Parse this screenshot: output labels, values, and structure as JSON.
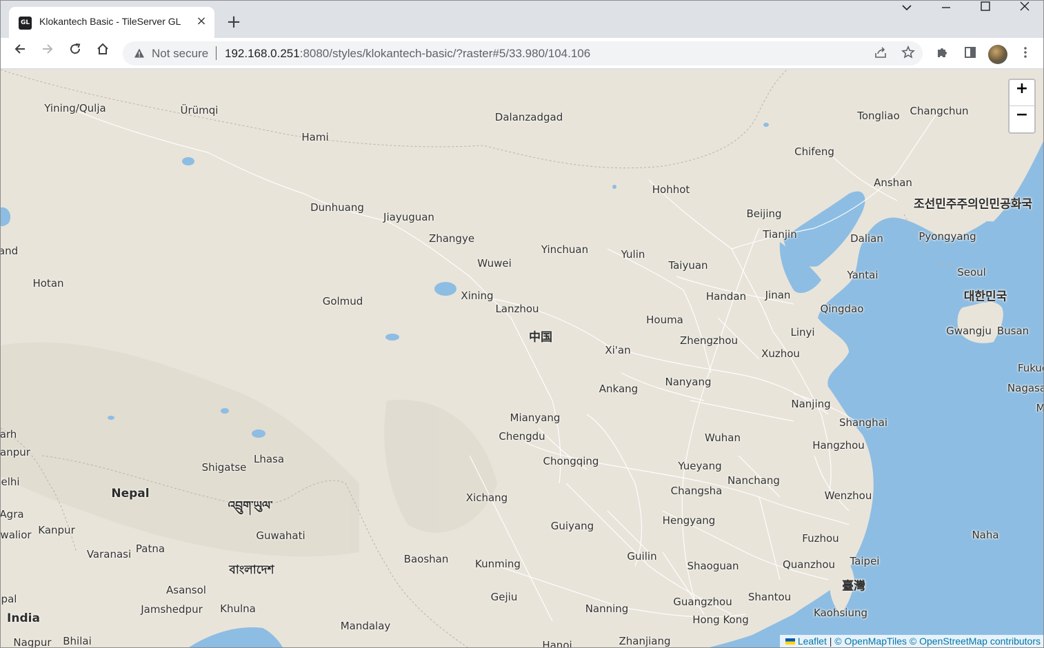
{
  "browser": {
    "tab_title": "Klokantech Basic - TileServer GL",
    "favicon_text": "GL",
    "new_tab_symbol": "+",
    "security_status": "Not secure",
    "url_host": "192.168.0.251",
    "url_rest": ":8080/styles/klokantech-basic/?raster#5/33.980/104.106"
  },
  "map": {
    "zoom_in_label": "+",
    "zoom_out_label": "−",
    "attribution": {
      "leaflet": "Leaflet",
      "separator": " | ",
      "omt": "© OpenMapTiles",
      "osm": "© OpenStreetMap contributors"
    },
    "colors": {
      "land": "#e8e4da",
      "water": "#8dbde3",
      "roads": "#ffffff",
      "borders": "#b9b4ac"
    },
    "labels": [
      {
        "text": "Yining/Qulja",
        "type": "city"
      },
      {
        "text": "Ürümqi",
        "type": "city"
      },
      {
        "text": "Dalanzadgad",
        "type": "city"
      },
      {
        "text": "Tongliao",
        "type": "city"
      },
      {
        "text": "Changchun",
        "type": "city"
      },
      {
        "text": "Hami",
        "type": "city"
      },
      {
        "text": "Chifeng",
        "type": "city"
      },
      {
        "text": "Hohhot",
        "type": "city"
      },
      {
        "text": "Anshan",
        "type": "city"
      },
      {
        "text": "조선민주주의인민공화국",
        "type": "country"
      },
      {
        "text": "Dunhuang",
        "type": "city"
      },
      {
        "text": "Jiayuguan",
        "type": "city"
      },
      {
        "text": "Beijing",
        "type": "city"
      },
      {
        "text": "Zhangye",
        "type": "city"
      },
      {
        "text": "Tianjin",
        "type": "city"
      },
      {
        "text": "Dalian",
        "type": "city"
      },
      {
        "text": "Pyongyang",
        "type": "city"
      },
      {
        "text": "and",
        "type": "city"
      },
      {
        "text": "Yinchuan",
        "type": "city"
      },
      {
        "text": "Yulin",
        "type": "city"
      },
      {
        "text": "Wuwei",
        "type": "city"
      },
      {
        "text": "Taiyuan",
        "type": "city"
      },
      {
        "text": "Seoul",
        "type": "city"
      },
      {
        "text": "Yantai",
        "type": "city"
      },
      {
        "text": "Hotan",
        "type": "city"
      },
      {
        "text": "대한민국",
        "type": "country"
      },
      {
        "text": "Xining",
        "type": "city"
      },
      {
        "text": "Handan",
        "type": "city"
      },
      {
        "text": "Jinan",
        "type": "city"
      },
      {
        "text": "Golmud",
        "type": "city"
      },
      {
        "text": "Lanzhou",
        "type": "city"
      },
      {
        "text": "Qingdao",
        "type": "city"
      },
      {
        "text": "Houma",
        "type": "city"
      },
      {
        "text": "Gwangju",
        "type": "city"
      },
      {
        "text": "Busan",
        "type": "city"
      },
      {
        "text": "中国",
        "type": "country"
      },
      {
        "text": "Linyi",
        "type": "city"
      },
      {
        "text": "Zhengzhou",
        "type": "city"
      },
      {
        "text": "Xi'an",
        "type": "city"
      },
      {
        "text": "Xuzhou",
        "type": "city"
      },
      {
        "text": "Fukuo",
        "type": "city"
      },
      {
        "text": "Nanyang",
        "type": "city"
      },
      {
        "text": "Ankang",
        "type": "city"
      },
      {
        "text": "Nagasa",
        "type": "city"
      },
      {
        "text": "Nanjing",
        "type": "city"
      },
      {
        "text": "M",
        "type": "city"
      },
      {
        "text": "Mianyang",
        "type": "city"
      },
      {
        "text": "Shanghai",
        "type": "city"
      },
      {
        "text": "arh",
        "type": "city"
      },
      {
        "text": "Chengdu",
        "type": "city"
      },
      {
        "text": "Wuhan",
        "type": "city"
      },
      {
        "text": "Hangzhou",
        "type": "city"
      },
      {
        "text": "anpur",
        "type": "city"
      },
      {
        "text": "Lhasa",
        "type": "city"
      },
      {
        "text": "Chongqing",
        "type": "city"
      },
      {
        "text": "Shigatse",
        "type": "city"
      },
      {
        "text": "Yueyang",
        "type": "city"
      },
      {
        "text": "elhi",
        "type": "city"
      },
      {
        "text": "Nanchang",
        "type": "city"
      },
      {
        "text": "Nepal",
        "type": "country"
      },
      {
        "text": "Changsha",
        "type": "city"
      },
      {
        "text": "Wenzhou",
        "type": "city"
      },
      {
        "text": "Xichang",
        "type": "city"
      },
      {
        "text": "འབྲུག་ཡུལ་",
        "type": "country"
      },
      {
        "text": "Agra",
        "type": "city"
      },
      {
        "text": "Hengyang",
        "type": "city"
      },
      {
        "text": "Kanpur",
        "type": "city"
      },
      {
        "text": "Guiyang",
        "type": "city"
      },
      {
        "text": "walior",
        "type": "city"
      },
      {
        "text": "Guwahati",
        "type": "city"
      },
      {
        "text": "Naha",
        "type": "city"
      },
      {
        "text": "Fuzhou",
        "type": "city"
      },
      {
        "text": "Patna",
        "type": "city"
      },
      {
        "text": "Varanasi",
        "type": "city"
      },
      {
        "text": "Guilin",
        "type": "city"
      },
      {
        "text": "Baoshan",
        "type": "city"
      },
      {
        "text": "Taipei",
        "type": "city"
      },
      {
        "text": "Kunming",
        "type": "city"
      },
      {
        "text": "Shaoguan",
        "type": "city"
      },
      {
        "text": "Quanzhou",
        "type": "city"
      },
      {
        "text": "বাংলাদেশ",
        "type": "country"
      },
      {
        "text": "臺灣",
        "type": "country"
      },
      {
        "text": "Asansol",
        "type": "city"
      },
      {
        "text": "Shantou",
        "type": "city"
      },
      {
        "text": "Gejiu",
        "type": "city"
      },
      {
        "text": "pal",
        "type": "city"
      },
      {
        "text": "Guangzhou",
        "type": "city"
      },
      {
        "text": "Jamshedpur",
        "type": "city"
      },
      {
        "text": "Khulna",
        "type": "city"
      },
      {
        "text": "Nanning",
        "type": "city"
      },
      {
        "text": "Kaohsiung",
        "type": "city"
      },
      {
        "text": "India",
        "type": "country"
      },
      {
        "text": "Hong Kong",
        "type": "city"
      },
      {
        "text": "Mandalay",
        "type": "city"
      },
      {
        "text": "Nagpur",
        "type": "city"
      },
      {
        "text": "Bhilai",
        "type": "city"
      },
      {
        "text": "Hanoi",
        "type": "city"
      },
      {
        "text": "Zhanjiang",
        "type": "city"
      }
    ]
  }
}
